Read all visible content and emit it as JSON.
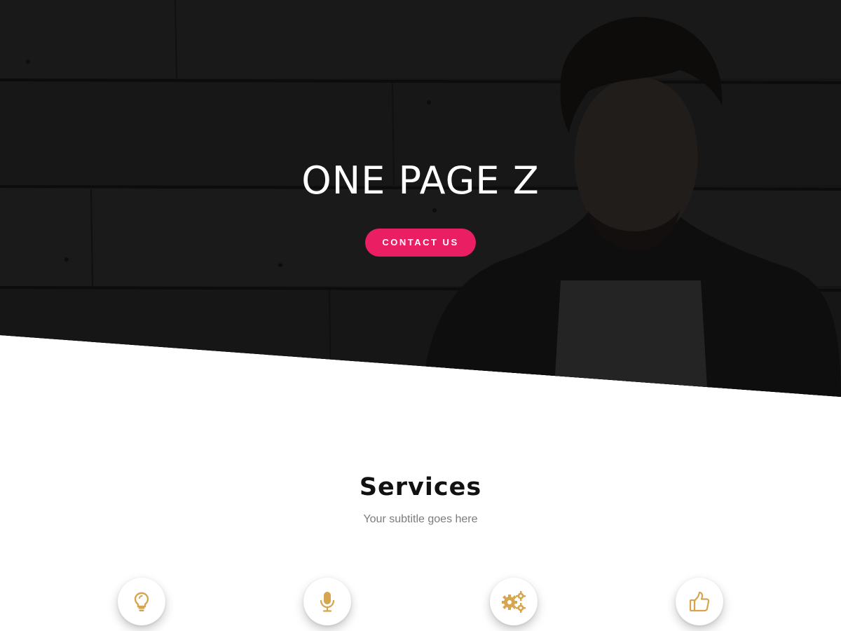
{
  "colors": {
    "accent": "#e91e63",
    "icon_gold": "#d6a54f",
    "hero_overlay": "#141313",
    "title_text": "#111111",
    "subtitle_text": "#7b7b7b"
  },
  "hero": {
    "title": "ONE PAGE Z",
    "cta_label": "CONTACT US"
  },
  "services": {
    "title": "Services",
    "subtitle": "Your subtitle goes here",
    "items": [
      {
        "icon": "lightbulb-icon"
      },
      {
        "icon": "microphone-icon"
      },
      {
        "icon": "gears-icon"
      },
      {
        "icon": "thumbs-up-icon"
      }
    ]
  }
}
